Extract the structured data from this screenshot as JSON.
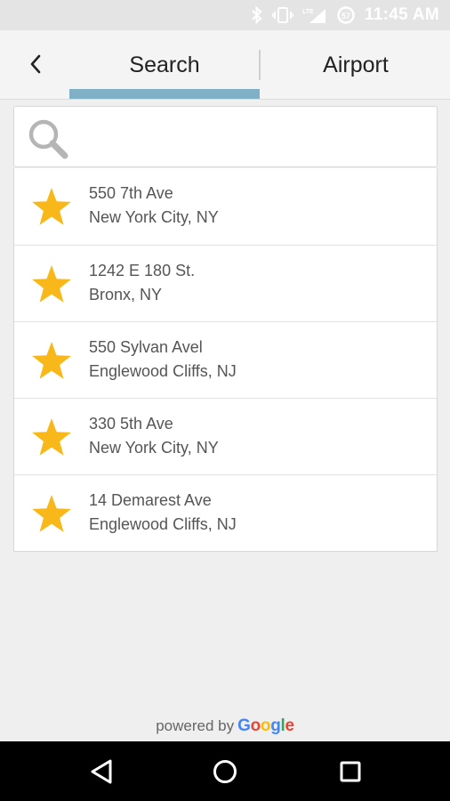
{
  "status_bar": {
    "time": "11:45 AM",
    "icons": [
      "bluetooth-icon",
      "vibrate-icon",
      "lte-signal-icon",
      "data-saver-icon"
    ]
  },
  "header": {
    "back_icon": "chevron-left-icon",
    "tabs": [
      {
        "label": "Search",
        "active": true
      },
      {
        "label": "Airport",
        "active": false
      }
    ],
    "accent_color": "#7fb0c6"
  },
  "search": {
    "icon": "search-icon",
    "value": "",
    "placeholder": ""
  },
  "favorites": {
    "icon": "star-icon",
    "star_color": "#f9b81a",
    "items": [
      {
        "line1": "550 7th Ave",
        "line2": "New York City, NY"
      },
      {
        "line1": "1242 E  180 St.",
        "line2": "Bronx, NY"
      },
      {
        "line1": "550 Sylvan Avel",
        "line2": "Englewood Cliffs, NJ"
      },
      {
        "line1": "330 5th Ave",
        "line2": "New York City, NY"
      },
      {
        "line1": "14 Demarest Ave",
        "line2": "Englewood Cliffs, NJ"
      }
    ]
  },
  "footer": {
    "powered_by": "powered by",
    "google_letters": [
      "G",
      "o",
      "o",
      "g",
      "l",
      "e"
    ]
  },
  "nav_bar": {
    "buttons": [
      "back-triangle-icon",
      "home-circle-icon",
      "recents-square-icon"
    ]
  }
}
